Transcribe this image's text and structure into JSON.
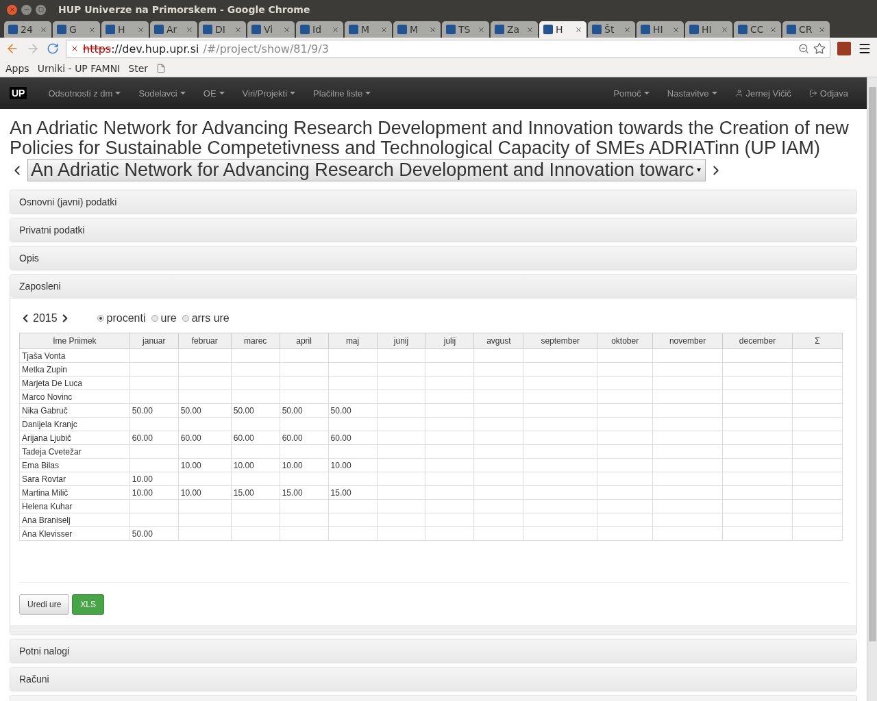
{
  "window": {
    "title": "HUP Univerze na Primorskem - Google Chrome"
  },
  "tabs": [
    {
      "label": "24",
      "selected": false
    },
    {
      "label": "G",
      "selected": false
    },
    {
      "label": "H",
      "selected": false
    },
    {
      "label": "Ar",
      "selected": false
    },
    {
      "label": "DI",
      "selected": false
    },
    {
      "label": "Vi",
      "selected": false
    },
    {
      "label": "Id",
      "selected": false
    },
    {
      "label": "M",
      "selected": false
    },
    {
      "label": "M",
      "selected": false
    },
    {
      "label": "TS",
      "selected": false
    },
    {
      "label": "Za",
      "selected": false
    },
    {
      "label": "H",
      "selected": true
    },
    {
      "label": "Št",
      "selected": false
    },
    {
      "label": "HI",
      "selected": false
    },
    {
      "label": "HI",
      "selected": false
    },
    {
      "label": "CC",
      "selected": false
    },
    {
      "label": "CR",
      "selected": false
    }
  ],
  "address_bar": {
    "scheme": "https",
    "host": "://dev.hup.upr.si",
    "path": "/#/project/show/81/9/3"
  },
  "bookmarks": [
    "Apps",
    "Urniki - UP FAMNI",
    "Ster"
  ],
  "navbar": {
    "brand": "UP",
    "left": [
      "Odsotnosti z dm",
      "Sodelavci",
      "OE",
      "Viri/Projekti",
      "Plačilne liste"
    ],
    "right": [
      {
        "label": "Pomoč",
        "kind": "dropdown"
      },
      {
        "label": "Nastavitve",
        "kind": "dropdown"
      },
      {
        "label": "Jernej Vičič",
        "kind": "user"
      },
      {
        "label": "Odjava",
        "kind": "logout"
      }
    ]
  },
  "page_title": "An Adriatic Network for Advancing Research Development and Innovation towards the Creation of new Policies for Sustainable Competetivness and Technological Capacity of SMEs ADRIATinn (UP IAM)",
  "project_select": {
    "value": "An Adriatic Network for Advancing Research Development and Innovation towarc"
  },
  "panels_top": [
    "Osnovni (javni) podatki",
    "Privatni podatki",
    "Opis"
  ],
  "employees_panel": {
    "title": "Zaposleni",
    "year": "2015",
    "units": [
      {
        "label": "procenti",
        "selected": true
      },
      {
        "label": "ure",
        "selected": false
      },
      {
        "label": "arrs ure",
        "selected": false
      }
    ],
    "table": {
      "columns": [
        "Ime Priimek",
        "januar",
        "februar",
        "marec",
        "april",
        "maj",
        "junij",
        "julij",
        "avgust",
        "september",
        "oktober",
        "november",
        "december",
        "Σ"
      ],
      "rows": [
        [
          "Tjaša Vonta",
          null,
          null,
          null,
          null,
          null,
          null,
          null,
          null,
          null,
          null,
          null,
          null,
          null
        ],
        [
          "Metka Zupin",
          null,
          null,
          null,
          null,
          null,
          null,
          null,
          null,
          null,
          null,
          null,
          null,
          null
        ],
        [
          "Marjeta De Luca",
          null,
          null,
          null,
          null,
          null,
          null,
          null,
          null,
          null,
          null,
          null,
          null,
          null
        ],
        [
          "Marco Novinc",
          null,
          null,
          null,
          null,
          null,
          null,
          null,
          null,
          null,
          null,
          null,
          null,
          null
        ],
        [
          "Nika Gabruč",
          "50.00",
          "50.00",
          "50.00",
          "50.00",
          "50.00",
          null,
          null,
          null,
          null,
          null,
          null,
          null,
          null
        ],
        [
          "Danijela Kranjc",
          null,
          null,
          null,
          null,
          null,
          null,
          null,
          null,
          null,
          null,
          null,
          null,
          null
        ],
        [
          "Arijana Ljubič",
          "60.00",
          "60.00",
          "60.00",
          "60.00",
          "60.00",
          null,
          null,
          null,
          null,
          null,
          null,
          null,
          null
        ],
        [
          "Tadeja Cvetežar",
          null,
          null,
          null,
          null,
          null,
          null,
          null,
          null,
          null,
          null,
          null,
          null,
          null
        ],
        [
          "Ema Bilas",
          null,
          "10.00",
          "10.00",
          "10.00",
          "10.00",
          null,
          null,
          null,
          null,
          null,
          null,
          null,
          null
        ],
        [
          "Sara Rovtar",
          "10.00",
          null,
          null,
          null,
          null,
          null,
          null,
          null,
          null,
          null,
          null,
          null,
          null
        ],
        [
          "Martina Milič",
          "10.00",
          "10.00",
          "15.00",
          "15.00",
          "15.00",
          null,
          null,
          null,
          null,
          null,
          null,
          null,
          null
        ],
        [
          "Helena Kuhar",
          null,
          null,
          null,
          null,
          null,
          null,
          null,
          null,
          null,
          null,
          null,
          null,
          null
        ],
        [
          "Ana Braniselj",
          null,
          null,
          null,
          null,
          null,
          null,
          null,
          null,
          null,
          null,
          null,
          null,
          null
        ],
        [
          "Ana Klevisser",
          "50.00",
          null,
          null,
          null,
          null,
          null,
          null,
          null,
          null,
          null,
          null,
          null,
          null
        ]
      ]
    },
    "buttons": [
      {
        "label": "Uredi ure",
        "kind": "default"
      },
      {
        "label": "XLS",
        "kind": "success"
      }
    ]
  },
  "panels_bottom": [
    "Potni nalogi",
    "Računi"
  ]
}
